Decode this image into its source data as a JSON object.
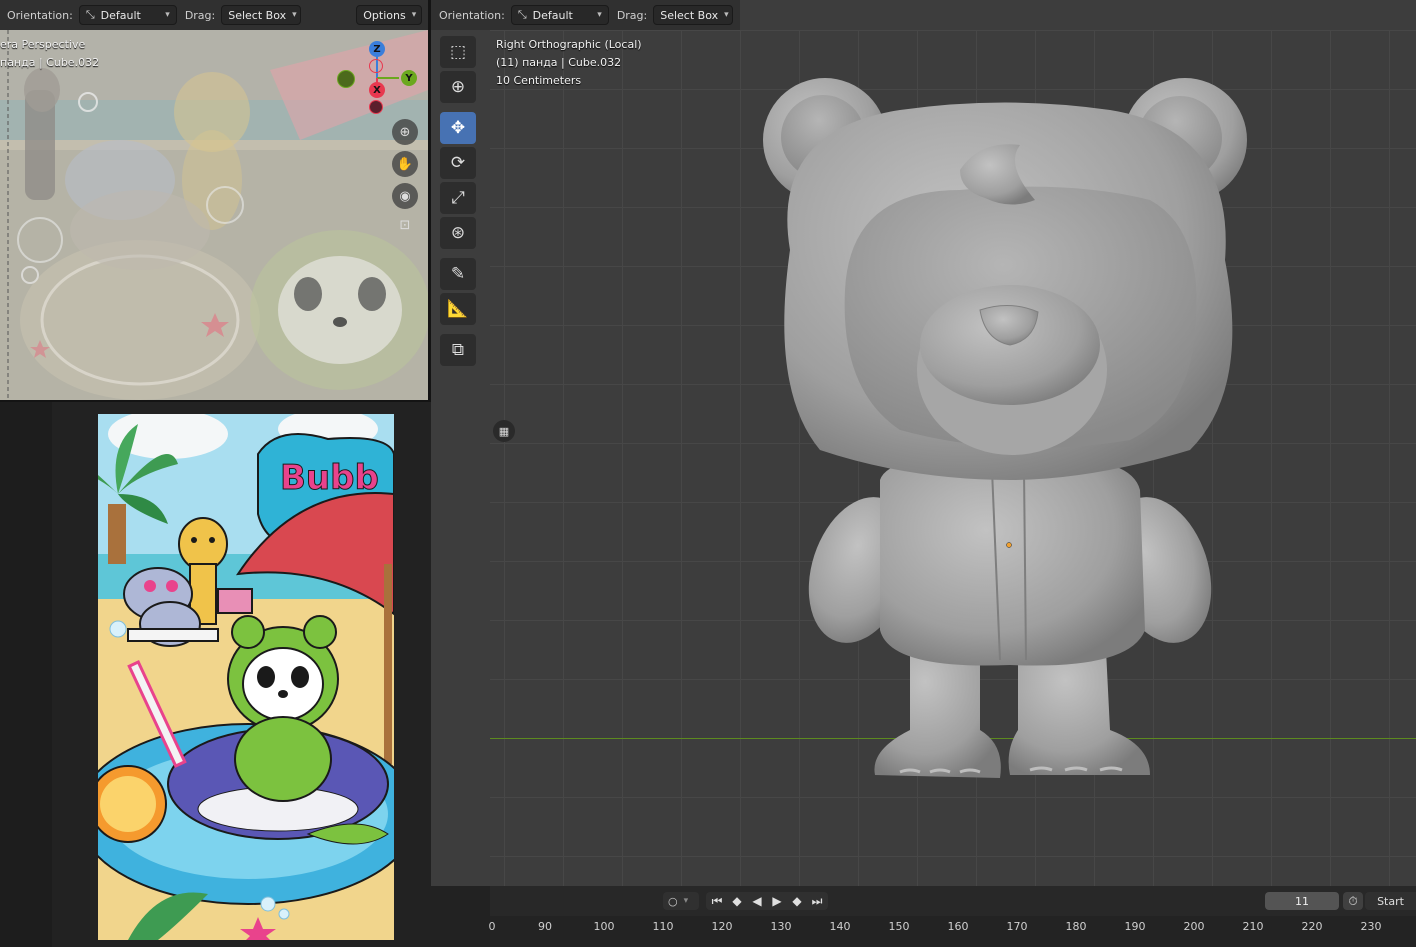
{
  "left_viewport": {
    "header": {
      "orientation_label": "Orientation:",
      "orientation_value": "Default",
      "drag_label": "Drag:",
      "drag_value": "Select Box",
      "options_label": "Options"
    },
    "overlay_line1": "era Perspective",
    "overlay_line2": "панда | Cube.032",
    "gizmo": {
      "z": "Z",
      "x": "X",
      "y": "Y"
    }
  },
  "right_viewport": {
    "header": {
      "orientation_label": "Orientation:",
      "orientation_value": "Default",
      "drag_label": "Drag:",
      "drag_value": "Select Box"
    },
    "overlay_line1": "Right Orthographic (Local)",
    "overlay_line2": "(11) панда | Cube.032",
    "overlay_line3": "10 Centimeters"
  },
  "reference_image": {
    "sign_text": "Bubble bar"
  },
  "timeline": {
    "current_frame": "11",
    "start_label": "Start",
    "ruler": [
      "0",
      "90",
      "100",
      "110",
      "120",
      "130",
      "140",
      "150",
      "160",
      "170",
      "180",
      "190",
      "200",
      "210",
      "220",
      "230"
    ]
  },
  "colors": {
    "active_tool": "#4772b3",
    "axis_x": "#e8384f",
    "axis_y": "#6ba81e",
    "axis_z": "#3a7edb"
  }
}
